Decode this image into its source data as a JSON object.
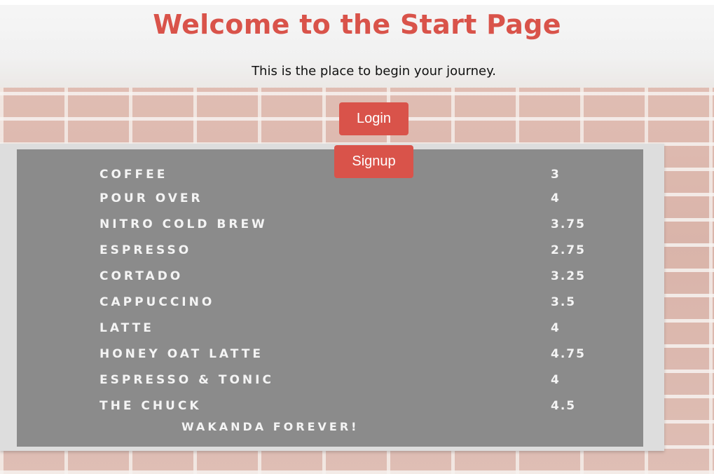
{
  "page": {
    "title": "Welcome to the Start Page",
    "subtitle": "This is the place to begin your journey.",
    "accent_color": "#d9534a"
  },
  "actions": {
    "login_label": "Login",
    "signup_label": "Signup"
  },
  "menu_board": {
    "items": [
      {
        "name": "COFFEE",
        "price": "3"
      },
      {
        "name": "POUR   OVER",
        "price": "4"
      },
      {
        "name": "NITRO  COLD  BREW",
        "price": "3.75"
      },
      {
        "name": "ESPRESSO",
        "price": "2.75"
      },
      {
        "name": "CORTADO",
        "price": "3.25"
      },
      {
        "name": "CAPPUCCINO",
        "price": "3.5"
      },
      {
        "name": "LATTE",
        "price": "4"
      },
      {
        "name": "HONEY  OAT LATTE",
        "price": "4.75"
      },
      {
        "name": "ESPRESSO & TONIC",
        "price": "4"
      },
      {
        "name": "THE   CHUCK",
        "price": "4.5"
      }
    ],
    "footer": "WAKANDA FOREVER!"
  }
}
